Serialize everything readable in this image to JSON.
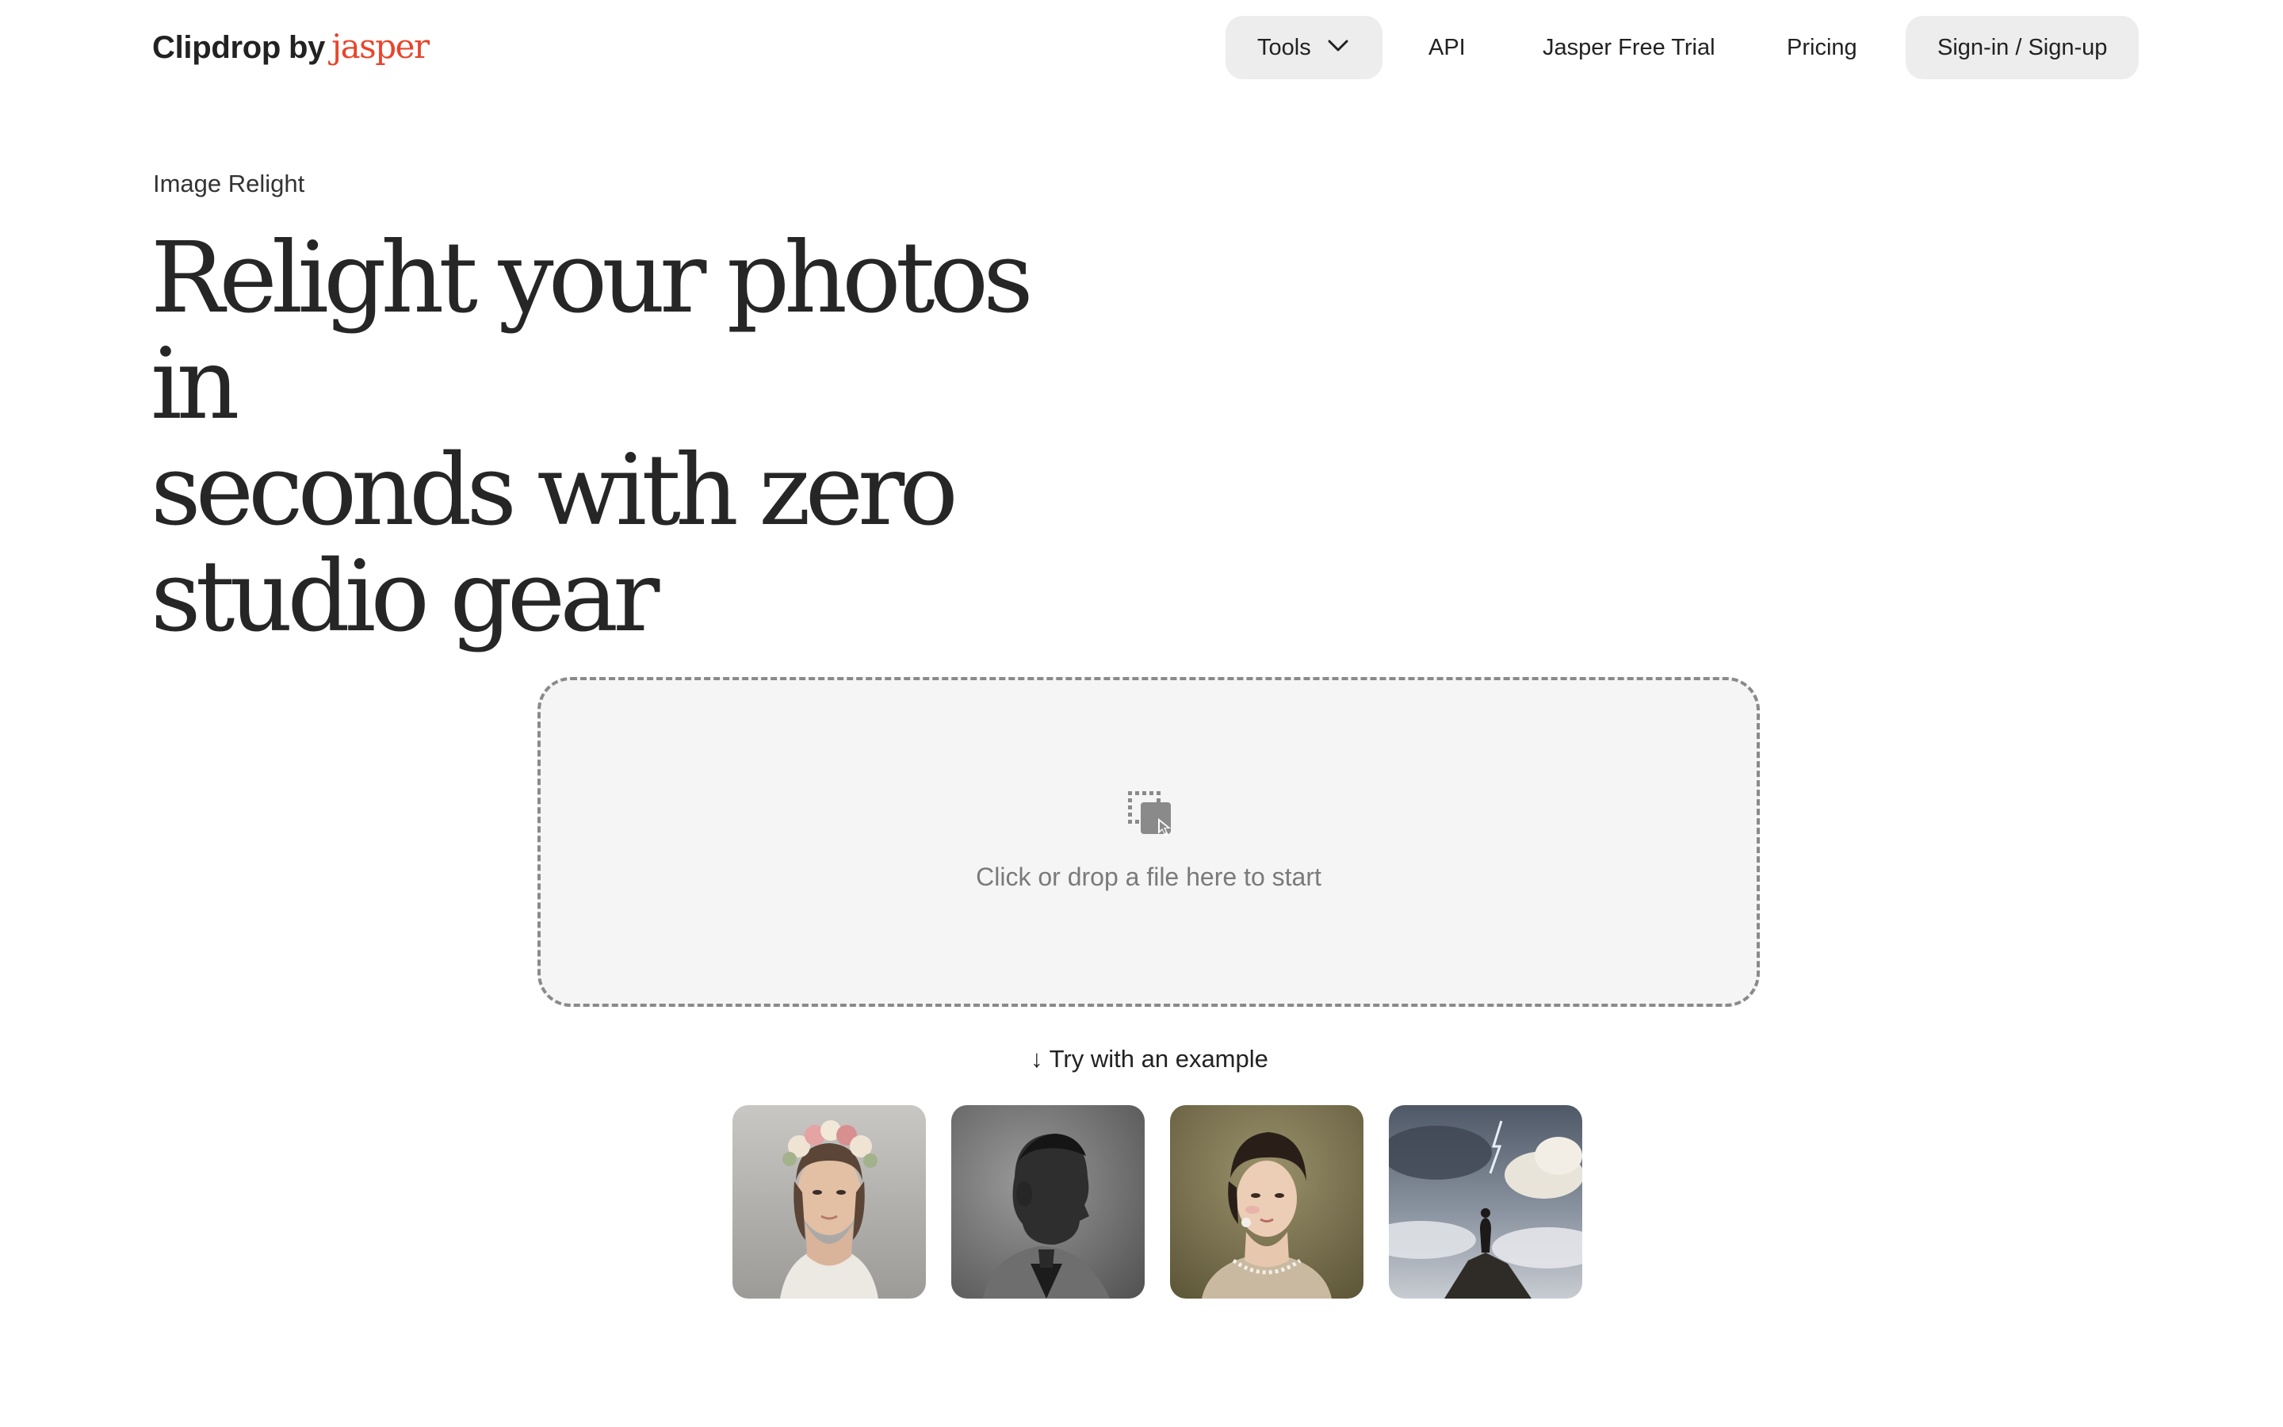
{
  "header": {
    "logo_main": "Clipdrop",
    "logo_by": "by",
    "logo_brand": "jasper",
    "nav": {
      "tools": "Tools",
      "api": "API",
      "trial": "Jasper Free Trial",
      "pricing": "Pricing",
      "signin": "Sign-in / Sign-up"
    }
  },
  "hero": {
    "eyebrow": "Image Relight",
    "headline_line1": "Relight your photos in",
    "headline_line2": "seconds with zero",
    "headline_line3": "studio gear"
  },
  "dropzone": {
    "text": "Click or drop a file here to start",
    "icon": "file-drop-icon"
  },
  "examples": {
    "label": "↓ Try with an example",
    "items": [
      {
        "icon": "woman-flower-crown-photo"
      },
      {
        "icon": "man-profile-bw-photo"
      },
      {
        "icon": "woman-painted-portrait"
      },
      {
        "icon": "wanderer-above-clouds-painting"
      }
    ]
  },
  "colors": {
    "brand_accent": "#e8452c",
    "pill_bg": "#ededed",
    "dropzone_bg": "#f5f5f5",
    "dropzone_border": "#8a8a8a",
    "text_dark": "#222222",
    "text_muted": "#7a7a7a"
  }
}
